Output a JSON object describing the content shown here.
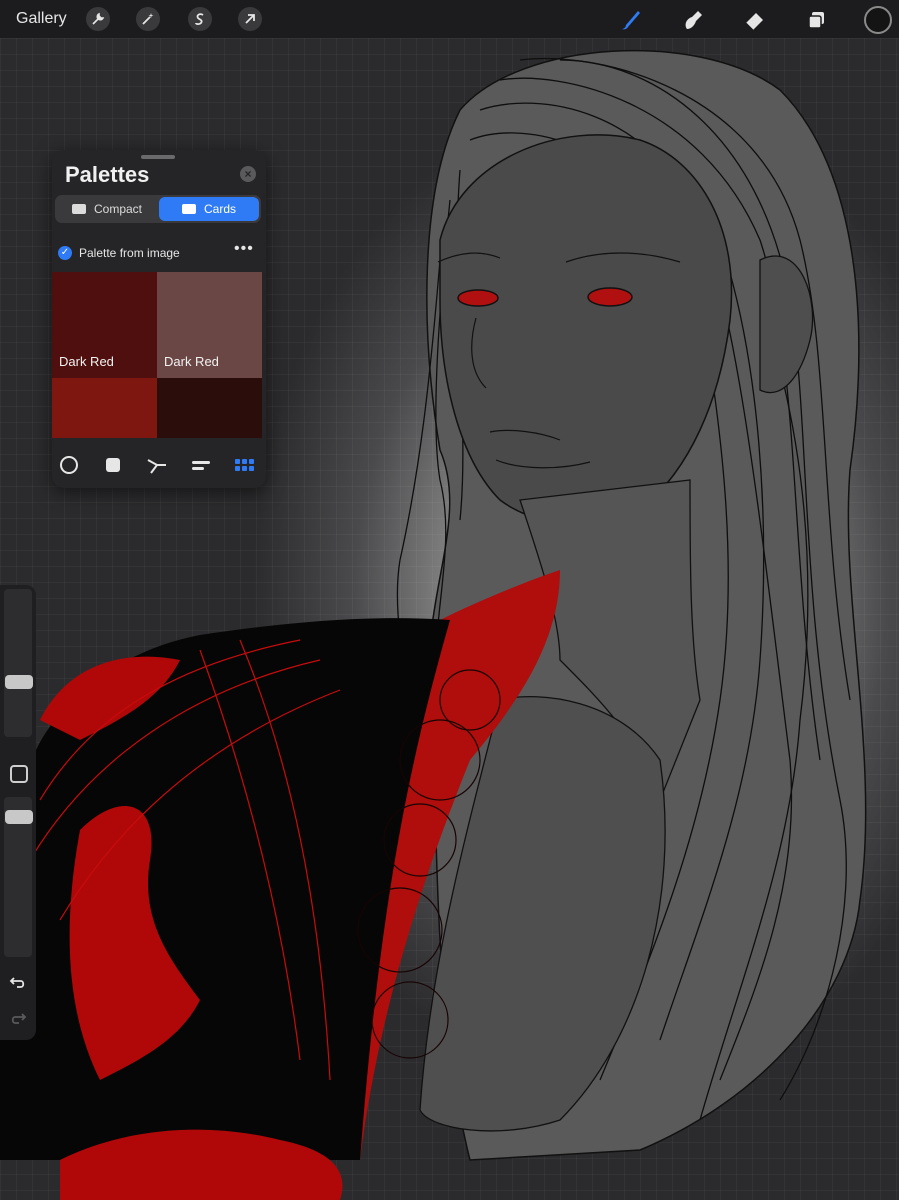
{
  "toolbar": {
    "gallery_label": "Gallery",
    "left_tools": [
      "wrench-icon",
      "magic-wand-icon",
      "selection-s-icon",
      "transform-arrow-icon"
    ],
    "right_tools": [
      "brush-icon",
      "smudge-icon",
      "eraser-icon",
      "layers-icon"
    ],
    "active_tool": "brush-icon",
    "accent_color": "#2f7bf5",
    "current_color": "#141414"
  },
  "palettes": {
    "title": "Palettes",
    "view_modes": [
      {
        "label": "Compact",
        "icon": "compact-icon",
        "active": false
      },
      {
        "label": "Cards",
        "icon": "cards-icon",
        "active": true
      }
    ],
    "palette": {
      "name": "Palette from image",
      "default": true,
      "more_label": "•••",
      "swatches": [
        {
          "label": "Dark Red",
          "color": "#4e0f0e"
        },
        {
          "label": "Dark Red",
          "color": "#6a4644"
        },
        {
          "label": "",
          "color": "#7d1710"
        },
        {
          "label": "",
          "color": "#2b0e0c"
        }
      ]
    },
    "footer_tabs": [
      "disc-icon",
      "classic-icon",
      "harmony-icon",
      "value-icon",
      "palettes-grid-icon"
    ],
    "active_footer_tab": "palettes-grid-icon"
  },
  "sidebar": {
    "brush_size_level": 0.36,
    "opacity_level": 0.91,
    "buttons": [
      "modify-icon",
      "undo-icon",
      "redo-icon"
    ]
  }
}
